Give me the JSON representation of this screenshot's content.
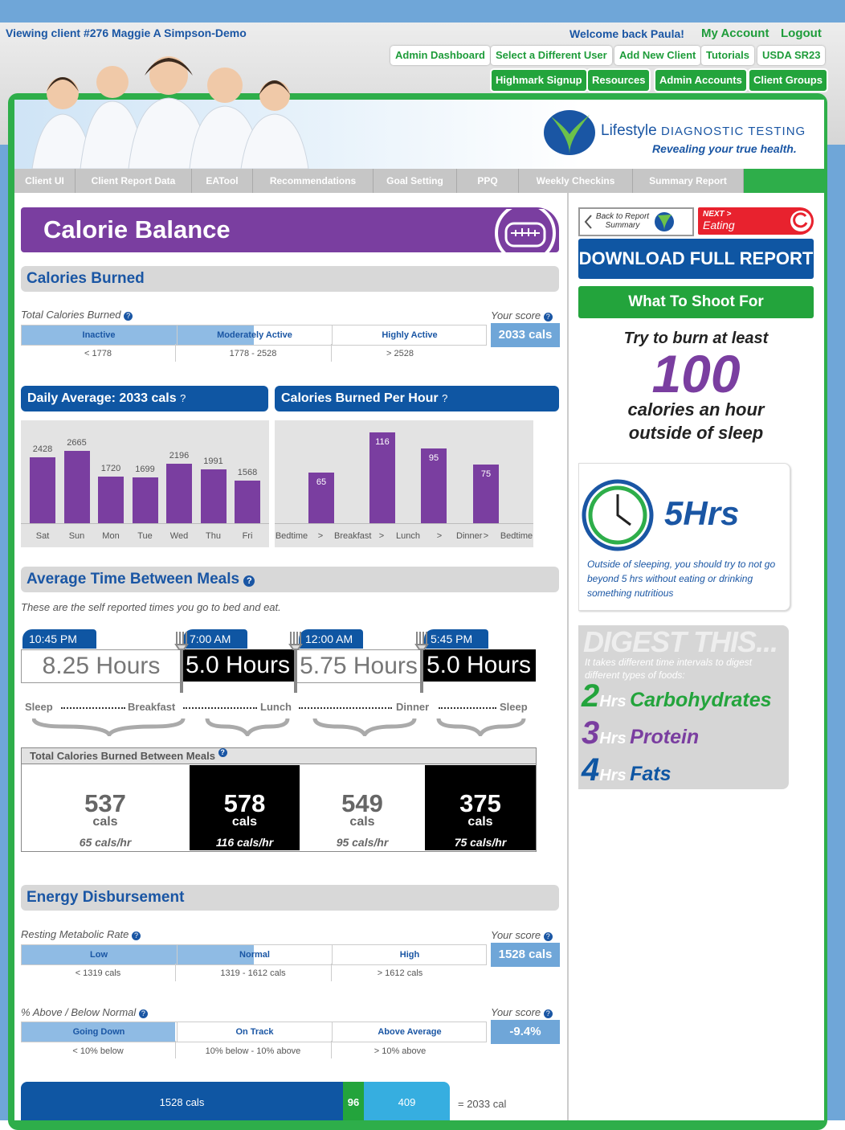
{
  "header": {
    "viewing": "Viewing client #276 Maggie A Simpson-Demo",
    "welcome": "Welcome back Paula!",
    "my_account": "My Account",
    "logout": "Logout",
    "buttons_row1": [
      "Admin Dashboard",
      "Select a Different User",
      "Add New Client",
      "Tutorials",
      "USDA SR23"
    ],
    "buttons_row2": [
      "Highmark Signup",
      "Resources",
      "Admin Accounts",
      "Client Groups"
    ]
  },
  "logo": {
    "brand": "Lifestyle",
    "brand2": "DIAGNOSTIC TESTING",
    "tagline": "Revealing your true health."
  },
  "nav_tabs": [
    "Client UI",
    "Client Report Data",
    "EATool",
    "Recommendations",
    "Goal Setting",
    "PPQ",
    "Weekly Checkins",
    "Summary Report"
  ],
  "page_title": "Calorie Balance",
  "calories_burned": {
    "heading": "Calories Burned",
    "label": "Total Calories Burned",
    "your_score_label": "Your score",
    "score": "2033 cals",
    "segments": [
      "Inactive",
      "Moderately Active",
      "Highly Active"
    ],
    "ranges": [
      "< 1778",
      "1778 - 2528",
      "> 2528"
    ],
    "fill_fraction": 0.5
  },
  "daily_avg_title": "Daily Average: 2033 cals",
  "per_hour_title": "Calories Burned Per Hour",
  "help_mark": "?",
  "chart_data": [
    {
      "type": "bar",
      "categories": [
        "Sat",
        "Sun",
        "Mon",
        "Tue",
        "Wed",
        "Thu",
        "Fri"
      ],
      "values": [
        2428,
        2665,
        1720,
        1699,
        2196,
        1991,
        1568
      ],
      "ylim": [
        0,
        3200
      ]
    },
    {
      "type": "bar",
      "categories": [
        "Bedtime",
        ">",
        "Breakfast",
        ">",
        "Lunch",
        ">",
        "Dinner",
        ">",
        "Bedtime"
      ],
      "bar_categories": [
        "Breakfast",
        "Lunch",
        "Dinner",
        "Bedtime"
      ],
      "values": [
        65,
        116,
        95,
        75
      ],
      "ylim": [
        0,
        125
      ]
    }
  ],
  "meals": {
    "heading": "Average Time Between Meals",
    "subtitle": "These are the self reported times you go to bed and eat.",
    "times": [
      "10:45 PM",
      "7:00 AM",
      "12:00 AM",
      "5:45 PM"
    ],
    "hours": [
      "8.25 Hours",
      "5.0 Hours",
      "5.75 Hours",
      "5.0 Hours"
    ],
    "labels": [
      "Sleep",
      "Breakfast",
      "Lunch",
      "Dinner",
      "Sleep"
    ],
    "table_title": "Total Calories Burned Between Meals",
    "cals": [
      "537",
      "578",
      "549",
      "375"
    ],
    "cals_unit": "cals",
    "rates": [
      "65 cals/hr",
      "116 cals/hr",
      "95 cals/hr",
      "75 cals/hr"
    ]
  },
  "energy": {
    "heading": "Energy Disbursement",
    "rmr_label": "Resting Metabolic Rate",
    "your_score_label": "Your score",
    "rmr_score": "1528 cals",
    "rmr_segments": [
      "Low",
      "Normal",
      "High"
    ],
    "rmr_ranges": [
      "< 1319 cals",
      "1319 - 1612 cals",
      "> 1612 cals"
    ],
    "rmr_fill_fraction": 0.5,
    "above_label": "% Above / Below Normal",
    "above_score": "-9.4%",
    "above_segments": [
      "Going Down",
      "On Track",
      "Above Average"
    ],
    "above_ranges": [
      "< 10% below",
      "10% below - 10% above",
      "> 10% above"
    ],
    "above_fill_fraction": 0.33,
    "stack": [
      "1528 cals",
      "96",
      "409"
    ],
    "stack_total": "= 2033 cal"
  },
  "sidebar": {
    "back": "Back to Report Summary",
    "next_small": "NEXT >",
    "next": "Eating",
    "download": "DOWNLOAD FULL REPORT",
    "shoot": "What To Shoot For",
    "try1": "Try to burn at least",
    "big": "100",
    "try2": "calories an hour",
    "try3": "outside of sleep",
    "hrs": "5Hrs",
    "hrs_note": "Outside of sleeping, you should try to not go beyond 5 hrs without eating or drinking something nutritious",
    "digest": "DIGEST THIS...",
    "digest_note": "It takes different time intervals to digest different types of foods:",
    "digest_items": [
      {
        "num": "2",
        "unit": "Hrs",
        "name": "Carbohydrates"
      },
      {
        "num": "3",
        "unit": "Hrs",
        "name": "Protein"
      },
      {
        "num": "4",
        "unit": "Hrs",
        "name": "Fats"
      }
    ]
  },
  "colors": {
    "brand_blue": "#0f56a3",
    "green": "#23a43c",
    "purple": "#7a3ea0",
    "light_blue": "#6fa6d8"
  }
}
